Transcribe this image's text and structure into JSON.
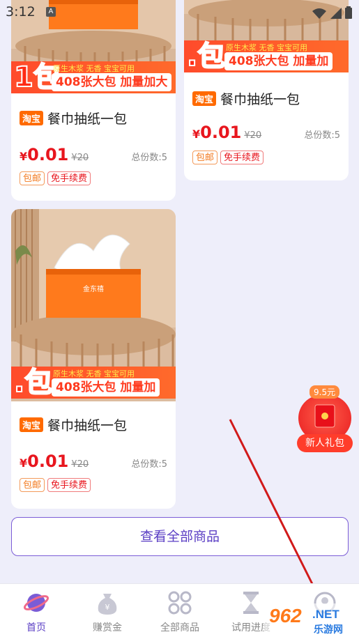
{
  "status_bar": {
    "time": "3:12",
    "a_icon": "A",
    "icons": [
      "wifi-icon",
      "signal-icon",
      "battery-icon"
    ]
  },
  "products": [
    {
      "banner_tag": "原生木浆 无香 宝宝可用",
      "banner_big": "408张大包 加量加大",
      "banner_pack": "1包",
      "platform_badge": "淘宝",
      "title": "餐巾抽纸一包",
      "price_symbol": "¥",
      "price": "0.01",
      "original_price": "¥20",
      "total_label": "总份数:5",
      "tags": [
        "包邮",
        "免手续费"
      ]
    },
    {
      "banner_tag": "原生木浆 无香 宝宝可用",
      "banner_big": "408张大包 加量加",
      "banner_pack": ".包",
      "platform_badge": "淘宝",
      "title": "餐巾抽纸一包",
      "price_symbol": "¥",
      "price": "0.01",
      "original_price": "¥20",
      "total_label": "总份数:5",
      "tags": [
        "包邮",
        "免手续费"
      ]
    },
    {
      "box_brand": "金东禧",
      "banner_tag": "原生木浆 无香 宝宝可用",
      "banner_big": "408张大包 加量加",
      "banner_pack": ".包",
      "platform_badge": "淘宝",
      "title": "餐巾抽纸一包",
      "price_symbol": "¥",
      "price": "0.01",
      "original_price": "¥20",
      "total_label": "总份数:5",
      "tags": [
        "包邮",
        "免手续费"
      ]
    }
  ],
  "view_all_label": "查看全部商品",
  "float_gift": {
    "price": "9.5元",
    "label": "新人礼包"
  },
  "tabs": [
    {
      "label": "首页",
      "icon": "planet-icon",
      "active": true
    },
    {
      "label": "赚赏金",
      "icon": "money-bag-icon",
      "active": false
    },
    {
      "label": "全部商品",
      "icon": "grid-icon",
      "active": false
    },
    {
      "label": "试用进度",
      "icon": "hourglass-icon",
      "active": false
    },
    {
      "label": "",
      "icon": "profile-icon",
      "active": false
    }
  ],
  "watermark": {
    "number": "962",
    "net": ".NET",
    "cn": "乐游网"
  },
  "colors": {
    "accent": "#5b3fc4",
    "price_red": "#e8161e",
    "taobao_orange": "#ff6a00",
    "page_bg": "#eeeefa"
  }
}
